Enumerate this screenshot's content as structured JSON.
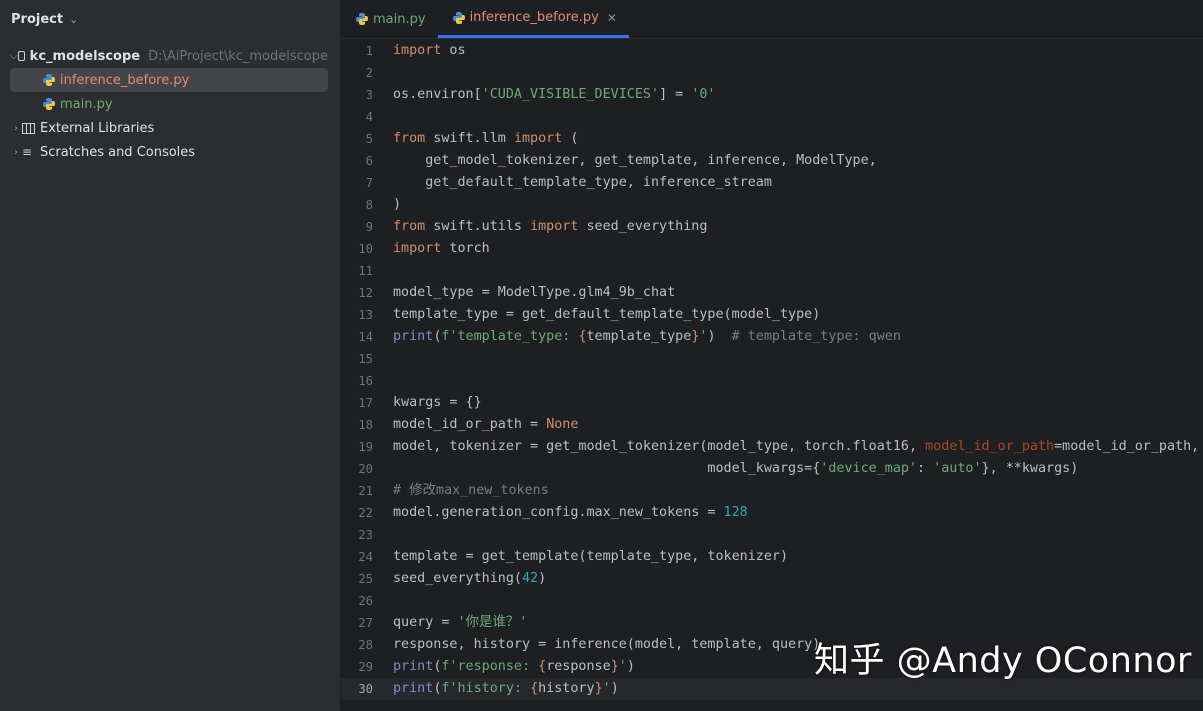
{
  "sidebar": {
    "title": "Project",
    "project_root": {
      "name": "kc_modelscope",
      "path": "D:\\AiProject\\kc_modelscope"
    },
    "files": [
      {
        "name": "inference_before.py",
        "status": "modified"
      },
      {
        "name": "main.py",
        "status": "added"
      }
    ],
    "external_libraries": "External Libraries",
    "scratches": "Scratches and Consoles"
  },
  "tabs": [
    {
      "label": "main.py",
      "active": false
    },
    {
      "label": "inference_before.py",
      "active": true
    }
  ],
  "editor": {
    "current_line": 30,
    "line_numbers": [
      "1",
      "2",
      "3",
      "4",
      "5",
      "6",
      "7",
      "8",
      "9",
      "10",
      "11",
      "12",
      "13",
      "14",
      "15",
      "16",
      "17",
      "18",
      "19",
      "20",
      "21",
      "22",
      "23",
      "24",
      "25",
      "26",
      "27",
      "28",
      "29",
      "30"
    ],
    "lines": [
      "import os",
      "",
      "os.environ['CUDA_VISIBLE_DEVICES'] = '0'",
      "",
      "from swift.llm import (",
      "    get_model_tokenizer, get_template, inference, ModelType,",
      "    get_default_template_type, inference_stream",
      ")",
      "from swift.utils import seed_everything",
      "import torch",
      "",
      "model_type = ModelType.glm4_9b_chat",
      "template_type = get_default_template_type(model_type)",
      "print(f'template_type: {template_type}')  # template_type: qwen",
      "",
      "",
      "kwargs = {}",
      "model_id_or_path = None",
      "model, tokenizer = get_model_tokenizer(model_type, torch.float16, model_id_or_path=model_id_or_path,",
      "                                       model_kwargs={'device_map': 'auto'}, **kwargs)",
      "# 修改max_new_tokens",
      "model.generation_config.max_new_tokens = 128",
      "",
      "template = get_template(template_type, tokenizer)",
      "seed_everything(42)",
      "",
      "query = '你是谁？'",
      "response, history = inference(model, template, query)",
      "print(f'response: {response}')",
      "print(f'history: {history}')"
    ]
  },
  "watermark": "知乎 @Andy OConnor",
  "colors": {
    "background": "#1e1f22",
    "sidebar": "#2b2d30",
    "keyword": "#cf8e6d",
    "string": "#6aab73",
    "number": "#2aacb8",
    "builtin": "#8888c6",
    "comment": "#7a7e85",
    "named_param": "#aa4926",
    "accent": "#3574f0",
    "modified_file": "#e88a72",
    "added_file": "#6aab73"
  }
}
